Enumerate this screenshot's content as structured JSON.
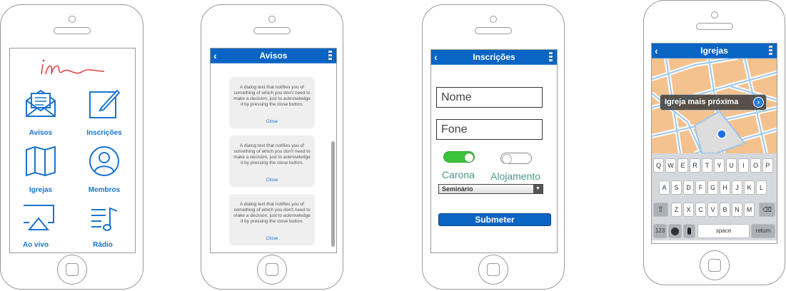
{
  "phone1": {
    "logo_text": "im",
    "items": [
      {
        "label": "Avisos",
        "icon": "envelope-icon"
      },
      {
        "label": "Inscrições",
        "icon": "pencil-icon"
      },
      {
        "label": "Igrejas",
        "icon": "map-icon"
      },
      {
        "label": "Membros",
        "icon": "person-icon"
      },
      {
        "label": "Ao vivo",
        "icon": "airplay-icon"
      },
      {
        "label": "Rádio",
        "icon": "music-list-icon"
      }
    ]
  },
  "phone2": {
    "title": "Avisos",
    "back": "‹",
    "dialogs": [
      {
        "text": "A dialog text that notifies you of something of which you don't need to make a decision, just to acknowledge it by pressing the close button.",
        "close": "Close"
      },
      {
        "text": "A dialog text that notifies you of something of which you don't need to make a decision, just to acknowledge it by pressing the close button.",
        "close": "Close"
      },
      {
        "text": "A dialog text that notifies you of something of which you don't need to make a decision, just to acknowledge it by pressing the close button.",
        "close": "Close"
      }
    ]
  },
  "phone3": {
    "title": "Inscrições",
    "back": "‹",
    "name_placeholder": "Nome",
    "phone_placeholder": "Fone",
    "toggle1_label": "Carona",
    "toggle1_on": true,
    "toggle2_label": "Alojamento",
    "toggle2_on": false,
    "select_value": "Seminário",
    "submit_label": "Submeter",
    "accent": "#0a64c4",
    "toggle_on_color": "#3cc33c"
  },
  "phone4": {
    "title": "Igrejas",
    "back": "‹",
    "callout": "Igreja mais próxima",
    "keyboard": {
      "row1": [
        "Q",
        "W",
        "E",
        "R",
        "T",
        "Y",
        "U",
        "I",
        "O",
        "P"
      ],
      "row2": [
        "A",
        "S",
        "D",
        "F",
        "G",
        "H",
        "J",
        "K",
        "L"
      ],
      "row3": [
        "Z",
        "X",
        "C",
        "V",
        "B",
        "N",
        "M"
      ],
      "num": "123",
      "space": "space",
      "return": "return"
    }
  }
}
